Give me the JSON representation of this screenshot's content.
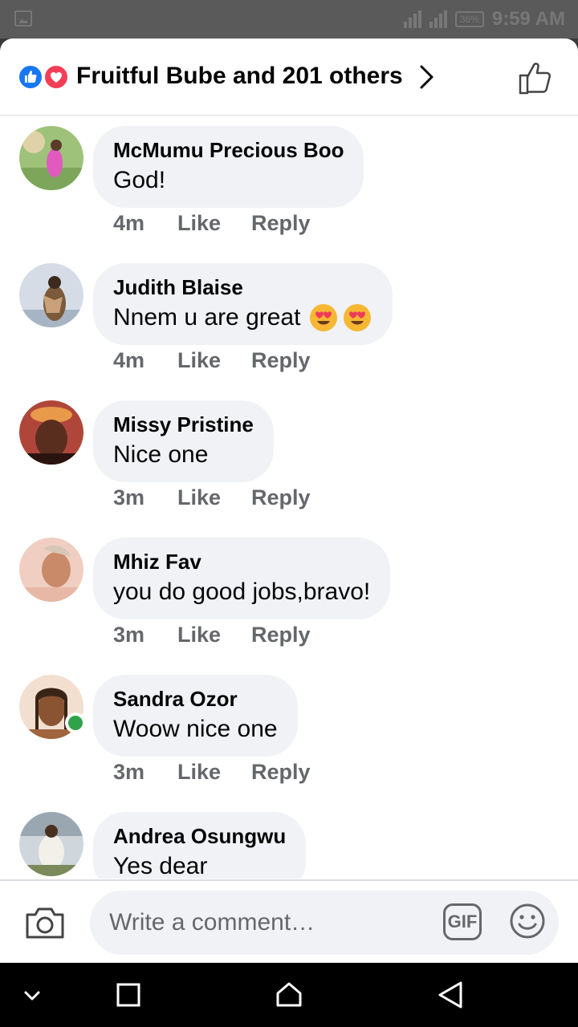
{
  "status_bar": {
    "battery": "36%",
    "time": "9:59 AM"
  },
  "header": {
    "reactors_text": "Fruitful Bube and 201 others"
  },
  "comments": [
    {
      "author": "McMumu Precious Boo",
      "text": "God!",
      "time": "4m",
      "like_label": "Like",
      "reply_label": "Reply",
      "emoji_count": 0,
      "online": false
    },
    {
      "author": "Judith Blaise",
      "text": "Nnem u are great",
      "time": "4m",
      "like_label": "Like",
      "reply_label": "Reply",
      "emoji_count": 2,
      "online": false
    },
    {
      "author": "Missy Pristine",
      "text": "Nice one",
      "time": "3m",
      "like_label": "Like",
      "reply_label": "Reply",
      "emoji_count": 0,
      "online": false
    },
    {
      "author": "Mhiz Fav",
      "text": "you do good jobs,bravo!",
      "time": "3m",
      "like_label": "Like",
      "reply_label": "Reply",
      "emoji_count": 0,
      "online": false
    },
    {
      "author": "Sandra Ozor",
      "text": "Woow nice one",
      "time": "3m",
      "like_label": "Like",
      "reply_label": "Reply",
      "emoji_count": 0,
      "online": true
    },
    {
      "author": "Andrea Osungwu",
      "text": "Yes dear",
      "time": "",
      "like_label": "",
      "reply_label": "",
      "emoji_count": 0,
      "online": false
    }
  ],
  "composer": {
    "placeholder": "Write a comment…",
    "gif_label": "GIF"
  },
  "colors": {
    "accent": "#1877f2",
    "love": "#f33e58",
    "online": "#31a24c",
    "bubble": "#f0f2f5",
    "secondary_text": "#65676b"
  }
}
